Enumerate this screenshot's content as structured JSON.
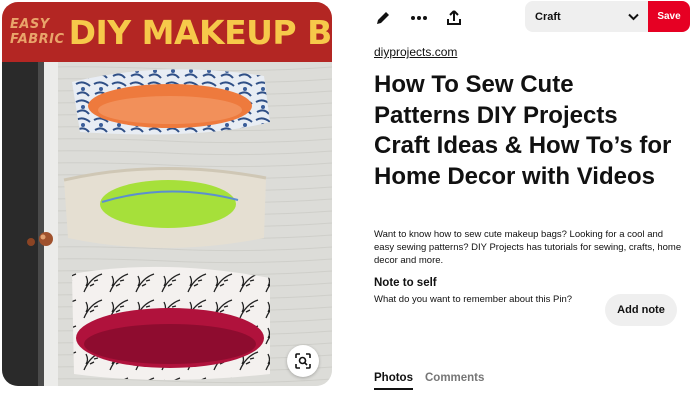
{
  "image": {
    "banner_small_line1": "EASY",
    "banner_small_line2": "FABRIC",
    "banner_big": "DIY MAKEUP BAG",
    "banner_color": "#b32623",
    "banner_text_color": "#f6c94a",
    "lens_icon": "visual-search-icon"
  },
  "toolbar": {
    "edit_icon": "pencil-icon",
    "more_icon": "ellipsis-icon",
    "share_icon": "share-upload-icon",
    "board_value": "Craft",
    "dropdown_icon": "chevron-down-icon",
    "save_label": "Save",
    "save_color": "#e60023"
  },
  "pin": {
    "domain": "diyprojects.com",
    "title": "How To Sew Cute Patterns DIY Projects Craft Ideas & How To’s for Home Decor with Videos",
    "description": "Want to know how to sew cute makeup bags? Looking for a cool and easy sewing patterns? DIY Projects has tutorials for sewing, crafts, home decor and more."
  },
  "note": {
    "heading": "Note to self",
    "prompt": "What do you want to remember about this Pin?",
    "add_label": "Add note"
  },
  "tabs": [
    {
      "label": "Photos",
      "active": true
    },
    {
      "label": "Comments",
      "active": false
    }
  ]
}
